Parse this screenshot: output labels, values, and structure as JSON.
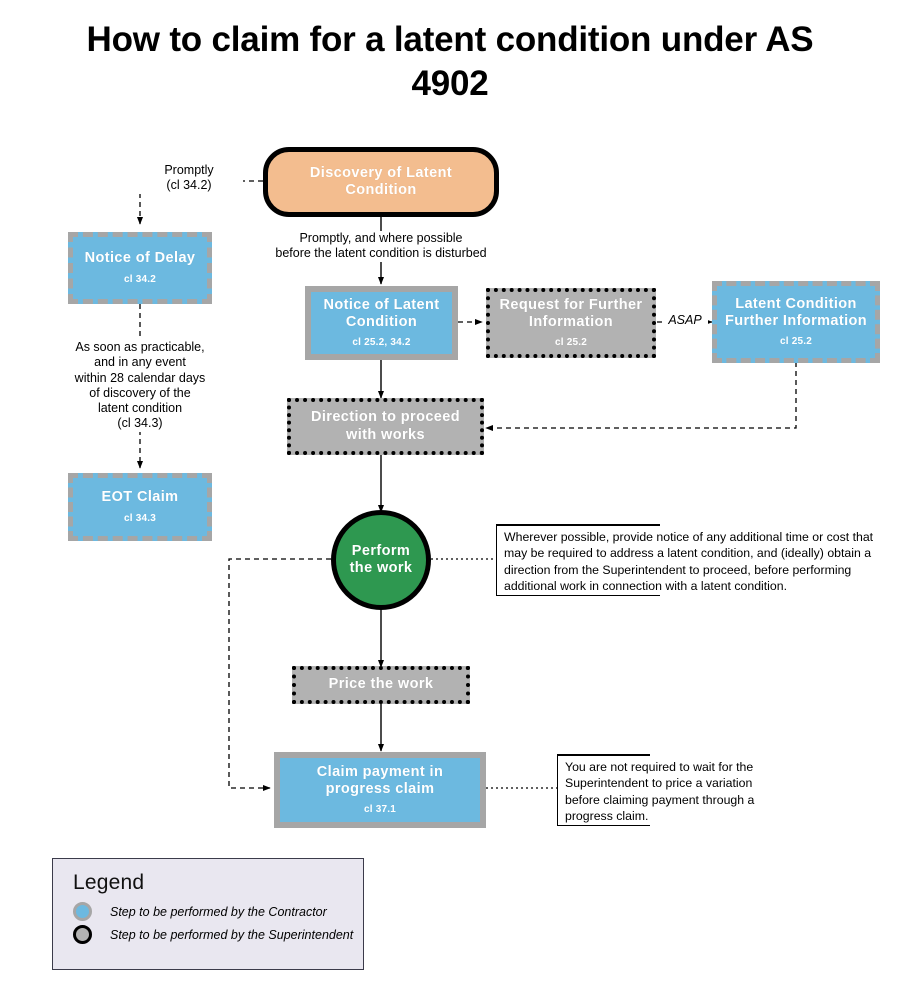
{
  "title": "How to claim for a latent condition\nunder AS 4902",
  "colors": {
    "contractor_fill": "#6cb9e0",
    "superintendent_fill": "#b2b2b2",
    "discovery_fill": "#f3bd8f",
    "perform_fill": "#2e9850",
    "legend_bg": "#e9e7f0",
    "node_border_gray": "#a6a6a6",
    "node_border_black": "#000000",
    "text_on_node": "#ffffff"
  },
  "nodes": {
    "discovery": {
      "label": "Discovery of\nLatent Condition",
      "clause": ""
    },
    "notice_of_delay": {
      "label": "Notice of Delay",
      "clause": "cl 34.2"
    },
    "eot_claim": {
      "label": "EOT Claim",
      "clause": "cl 34.3"
    },
    "notice_of_latent_condition": {
      "label": "Notice of Latent\nCondition",
      "clause": "cl 25.2, 34.2"
    },
    "request_further_information": {
      "label": "Request for Further\nInformation",
      "clause": "cl 25.2"
    },
    "latent_condition_further_information": {
      "label": "Latent Condition\nFurther Information",
      "clause": "cl 25.2"
    },
    "direction_to_proceed": {
      "label": "Direction to proceed\nwith works",
      "clause": ""
    },
    "perform_the_work": {
      "label": "Perform the\nwork",
      "clause": ""
    },
    "price_the_work": {
      "label": "Price the work",
      "clause": ""
    },
    "claim_payment": {
      "label": "Claim payment in\nprogress claim",
      "clause": "cl 37.1"
    }
  },
  "edge_labels": {
    "promptly_cl342": "Promptly\n(cl 34.2)",
    "promptly_before_disturbed": "Promptly, and where possible\nbefore the latent condition is disturbed",
    "as_soon_as_practicable": "As soon as practicable,\nand in any event\nwithin 28 calendar days\nof discovery of the\nlatent condition\n(cl 34.3)",
    "asap": "ASAP"
  },
  "callouts": {
    "perform_note": "Wherever possible, provide notice of any additional time or cost that may be required to address a latent condition, and (ideally) obtain a direction from the Superintendent to proceed, before performing additional work in connection with a latent condition.",
    "claim_note": "You are not required to wait for the Superintendent to price a variation before claiming payment through a progress claim."
  },
  "legend": {
    "title": "Legend",
    "items": [
      {
        "label": "Step to be performed by the Contractor",
        "swatch": "contractor-circle"
      },
      {
        "label": "Step to be performed by the Superintendent",
        "swatch": "superintendent-circle"
      }
    ]
  }
}
